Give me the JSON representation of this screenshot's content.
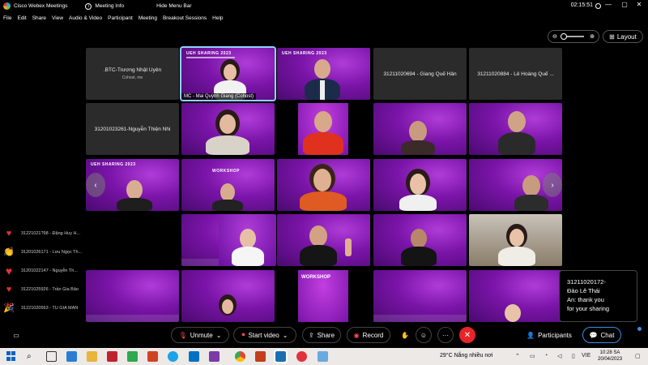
{
  "window": {
    "app_title": "Cisco Webex Meetings",
    "meeting_info_label": "Meeting Info",
    "hide_menu_label": "Hide Menu Bar",
    "clock": "02:15:51",
    "minimize": "—",
    "maximize": "▢",
    "close": "✕"
  },
  "menu": [
    "File",
    "Edit",
    "Share",
    "View",
    "Audio & Video",
    "Participant",
    "Meeting",
    "Breakout Sessions",
    "Help"
  ],
  "view_controls": {
    "zoom_minus": "⊖",
    "zoom_plus": "⊕",
    "layout_label": "Layout",
    "layout_icon": "⊞"
  },
  "tiles": {
    "t1": {
      "name": ".BTC-Trương Nhật Uyên",
      "role": "Cohost, me"
    },
    "t2": {
      "label": "MC - Mai Quỳnh Giang (Cohost)",
      "banner": "UEH SHARING 2023"
    },
    "t3": {
      "banner": "UEH SHARING 2023"
    },
    "t4": {
      "name": "31211020694 - Giang Quế Hân"
    },
    "t5": {
      "name": "31211020884 - Lê Hoàng Quế ..."
    },
    "t6": {
      "name": "31201023261-Nguyễn Thiện Nhi"
    },
    "workshop1": "WORKSHOP",
    "workshop2": "WORKSHOP",
    "banner": "UEH SHARING 2023"
  },
  "nav": {
    "prev": "‹",
    "next": "›"
  },
  "reactions": [
    {
      "icon": "heart-icon",
      "glyph": "♥",
      "color": "#e0323c",
      "name": "31221021?98 - Đặng Huy H..."
    },
    {
      "icon": "clap-icon",
      "glyph": "👏",
      "color": "#f4b400",
      "name": "31201026171 - Lưu Ngọc Th..."
    },
    {
      "icon": "heart-icon",
      "glyph": "♥",
      "color": "#e0323c",
      "name": "31201022147 - Nguyễn Th..."
    },
    {
      "icon": "heart-icon",
      "glyph": "♥",
      "color": "#e0323c",
      "name": "31221025926 - Trần Gia Bảo"
    },
    {
      "icon": "party-icon",
      "glyph": "🎉",
      "color": "#f4b400",
      "name": "31221020563 - TU GIA MAN"
    }
  ],
  "chat_popup": {
    "line1": "31211020172-",
    "line2": "Đào Lê Thái",
    "line3": "An: thank you",
    "line4": "for your sharing"
  },
  "controls": {
    "unmute": "Unmute",
    "start_video": "Start video",
    "share": "Share",
    "record": "Record",
    "participants": "Participants",
    "chat": "Chat",
    "more": "···",
    "leave": "✕"
  },
  "taskbar": {
    "weather": "29°C  Nắng nhiều nơi",
    "lang": "VIE",
    "time": "10:28 SA",
    "date": "20/04/2023"
  }
}
